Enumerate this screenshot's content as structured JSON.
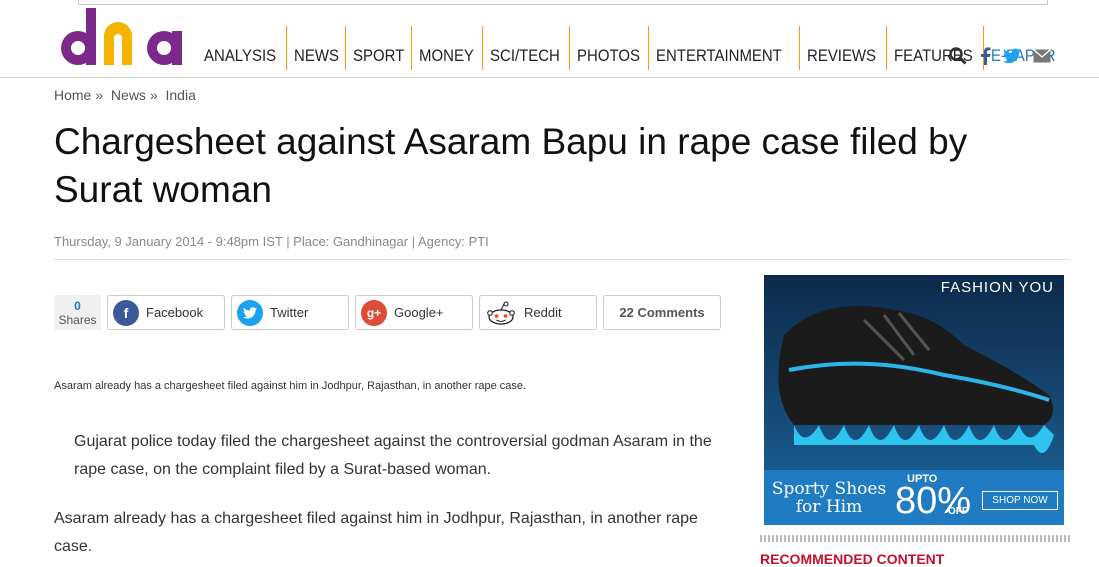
{
  "header": {
    "nav": [
      "ANALYSIS",
      "NEWS",
      "SPORT",
      "MONEY",
      "SCI/TECH",
      "PHOTOS",
      "ENTERTAINMENT",
      "REVIEWS",
      "FEATURES",
      "E-PAPER"
    ],
    "logo_text": "dna",
    "icons": [
      "search-icon",
      "facebook-icon",
      "twitter-icon",
      "mail-icon"
    ]
  },
  "breadcrumb": [
    "Home »",
    "News »",
    "India"
  ],
  "article": {
    "title": "Chargesheet against Asaram Bapu in rape case filed by Surat woman",
    "meta": "Thursday, 9 January 2014 - 9:48pm IST | Place: Gandhinagar | Agency: PTI",
    "caption": "Asaram already has a chargesheet filed against him in Jodhpur, Rajasthan, in another rape case.",
    "quote": "Gujarat police today filed the chargesheet against the controversial godman Asaram in the rape case, on the complaint filed by a Surat-based woman.",
    "para": "Asaram already has a chargesheet filed against him in Jodhpur, Rajasthan, in another rape case."
  },
  "share": {
    "count": "0",
    "count_label": "Shares",
    "facebook": "Facebook",
    "twitter": "Twitter",
    "google": "Google+",
    "reddit": "Reddit",
    "comments": "22 Comments"
  },
  "ad": {
    "brand": "FASHION YOU",
    "tagline": "Sporty Shoes for Him",
    "upto": "UPTO",
    "percent": "80%",
    "off": "OFF",
    "cta": "SHOP NOW"
  },
  "sidebar": {
    "recommended": "RECOMMENDED CONTENT"
  },
  "colors": {
    "accent": "#2677b8",
    "nav_separator": "#f0a000",
    "facebook": "#3b5998",
    "twitter": "#1da1f2",
    "google": "#dd4b39",
    "recommended": "#c4102e"
  }
}
